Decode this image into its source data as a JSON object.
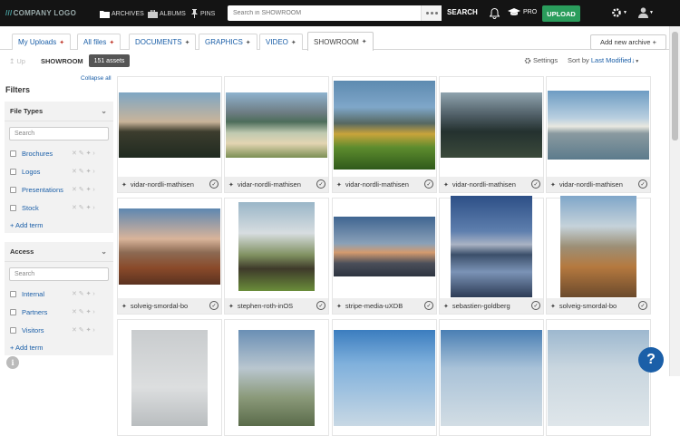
{
  "topbar": {
    "logo_slashes": "///",
    "logo_text": "COMPANY LOGO",
    "nav": [
      {
        "label": "ARCHIVES",
        "icon": "folder-icon"
      },
      {
        "label": "ALBUMS",
        "icon": "briefcase-icon"
      },
      {
        "label": "PINS",
        "icon": "pin-icon"
      }
    ],
    "search_placeholder": "Search in SHOWROOM",
    "search_label": "SEARCH",
    "pro_label": "PRO",
    "upload_label": "UPLOAD"
  },
  "tabs": [
    {
      "label": "My Uploads",
      "pin": "red"
    },
    {
      "label": "All files",
      "pin": "red"
    },
    {
      "label": "DOCUMENTS",
      "pin": "gray"
    },
    {
      "label": "GRAPHICS",
      "pin": "gray"
    },
    {
      "label": "VIDEO",
      "pin": "gray"
    },
    {
      "label": "SHOWROOM",
      "pin": "gray",
      "active": true
    }
  ],
  "add_archive_label": "Add new archive +",
  "subbar": {
    "up_label": "Up",
    "current": "SHOWROOM",
    "asset_count": "151 assets",
    "settings_label": "Settings",
    "sort_prefix": "Sort by",
    "sort_value": "Last Modified"
  },
  "filters": {
    "title": "Filters",
    "collapse_all": "Collapse all",
    "panels": [
      {
        "title": "File Types",
        "search_placeholder": "Search",
        "terms": [
          "Brochures",
          "Logos",
          "Presentations",
          "Stock"
        ],
        "add_term": "+ Add term"
      },
      {
        "title": "Access",
        "search_placeholder": "Search",
        "terms": [
          "Internal",
          "Partners",
          "Visitors"
        ],
        "add_term": "+ Add term"
      }
    ]
  },
  "assets": [
    {
      "name": "vidar-nordli-mathisen",
      "scene": "lighthouse-dusk"
    },
    {
      "name": "vidar-nordli-mathisen",
      "scene": "beach-mountains"
    },
    {
      "name": "vidar-nordli-mathisen",
      "scene": "yellow-cabin"
    },
    {
      "name": "vidar-nordli-mathisen",
      "scene": "dark-peaks"
    },
    {
      "name": "vidar-nordli-mathisen",
      "scene": "lighthouse-reflection"
    },
    {
      "name": "solveig-smordal-bo",
      "scene": "autumn-sunset"
    },
    {
      "name": "stephen-roth-inOS",
      "scene": "stave-church"
    },
    {
      "name": "stripe-media-uXDB",
      "scene": "boat-dusk"
    },
    {
      "name": "sebastien-goldberg",
      "scene": "fjord-reflection"
    },
    {
      "name": "solveig-smordal-bo",
      "scene": "golden-valley"
    },
    {
      "name": "",
      "scene": "misty-trees"
    },
    {
      "name": "",
      "scene": "cloudy-hills"
    },
    {
      "name": "",
      "scene": "blue-coast"
    },
    {
      "name": "",
      "scene": "fjord-clouds"
    },
    {
      "name": "",
      "scene": "sea-stacks"
    }
  ],
  "colors": {
    "topbar": "#141414",
    "upload": "#2a9d5c",
    "link": "#1b5fa8",
    "help": "#1b5fa8"
  },
  "help_label": "?",
  "info_label": "i"
}
